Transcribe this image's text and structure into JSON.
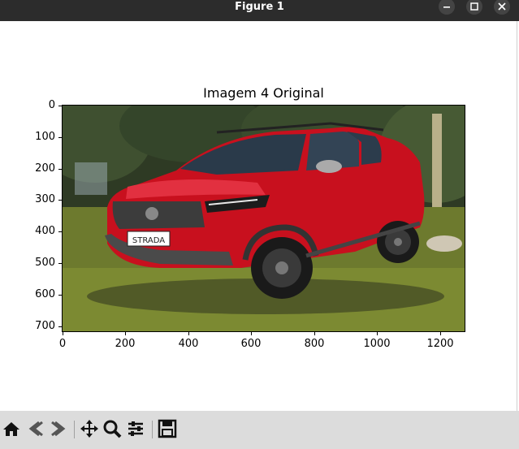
{
  "window": {
    "title": "Figure 1",
    "controls": [
      "minimize-icon",
      "maximize-icon",
      "close-icon"
    ]
  },
  "figure": {
    "title": "Imagem 4 Original",
    "image_description_icon": "photo-red-pickup-truck",
    "yticks": [
      "0",
      "100",
      "200",
      "300",
      "400",
      "500",
      "600",
      "700"
    ],
    "xticks": [
      "0",
      "200",
      "400",
      "600",
      "800",
      "1000",
      "1200"
    ],
    "plate_text": "STRADA"
  },
  "toolbar": {
    "buttons": [
      "home-icon",
      "back-icon",
      "forward-icon",
      "pan-icon",
      "zoom-icon",
      "configure-subplots-icon",
      "save-icon"
    ]
  }
}
